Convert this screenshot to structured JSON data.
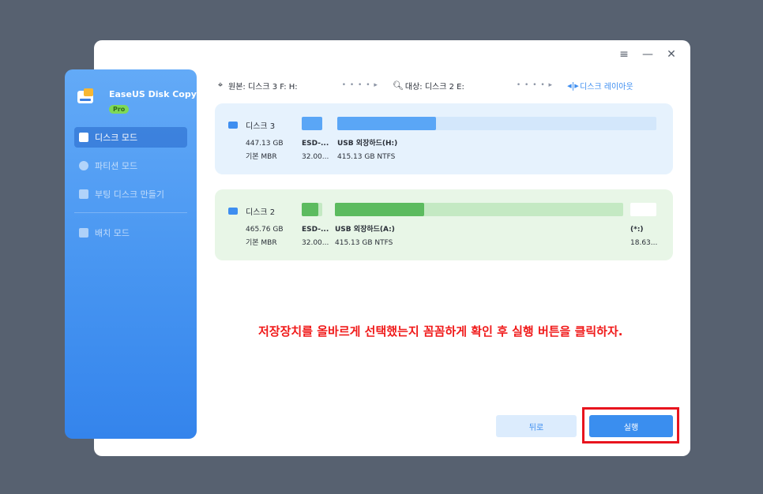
{
  "window_controls": {
    "menu": "≡",
    "minimize": "—",
    "close": "✕"
  },
  "sidebar": {
    "app_name": "EaseUS Disk Copy",
    "badge": "Pro",
    "items": [
      {
        "label": "디스크 모드",
        "icon": "disk-mode-icon",
        "active": true
      },
      {
        "label": "파티션 모드",
        "icon": "partition-mode-icon",
        "active": false
      },
      {
        "label": "부팅 디스크 만들기",
        "icon": "boot-disk-icon",
        "active": false
      },
      {
        "label": "배치 모드",
        "icon": "batch-mode-icon",
        "active": false
      }
    ]
  },
  "path_bar": {
    "source_label": "원본: 디스크 3 F: H:",
    "dots": "• • • • ▸",
    "target_label": "대상: 디스크 2 E:",
    "dots2": "• • • • ▸",
    "layout_label": "디스크 레이아웃"
  },
  "source_disk": {
    "name": "디스크 3",
    "size": "447.13 GB",
    "type": "기본 MBR",
    "part1_name": "ESD-...",
    "part1_size": "32.00...",
    "part2_name": "USB 외장하드(H:)",
    "part2_info": "415.13 GB NTFS",
    "part2_used_fraction": 0.31,
    "colors": {
      "card": "#e6f2fd",
      "used": "#5aa6f6",
      "free": "#d3e7fb"
    }
  },
  "target_disk": {
    "name": "디스크 2",
    "size": "465.76 GB",
    "type": "기본 MBR",
    "part1_name": "ESD-...",
    "part1_size": "32.00...",
    "part2_name": "USB 외장하드(A:)",
    "part2_info": "415.13 GB NTFS",
    "part2_used_fraction": 0.31,
    "part3_name": "(*:)",
    "part3_size": "18.63...",
    "colors": {
      "card": "#e8f6e7",
      "used": "#5cbb5f",
      "free": "#c4e9c3"
    }
  },
  "annotation": "저장장치를 올바르게 선택했는지 꼼꼼하게 확인 후 실행 버튼을 클릭하자.",
  "buttons": {
    "back": "뒤로",
    "run": "실행"
  }
}
